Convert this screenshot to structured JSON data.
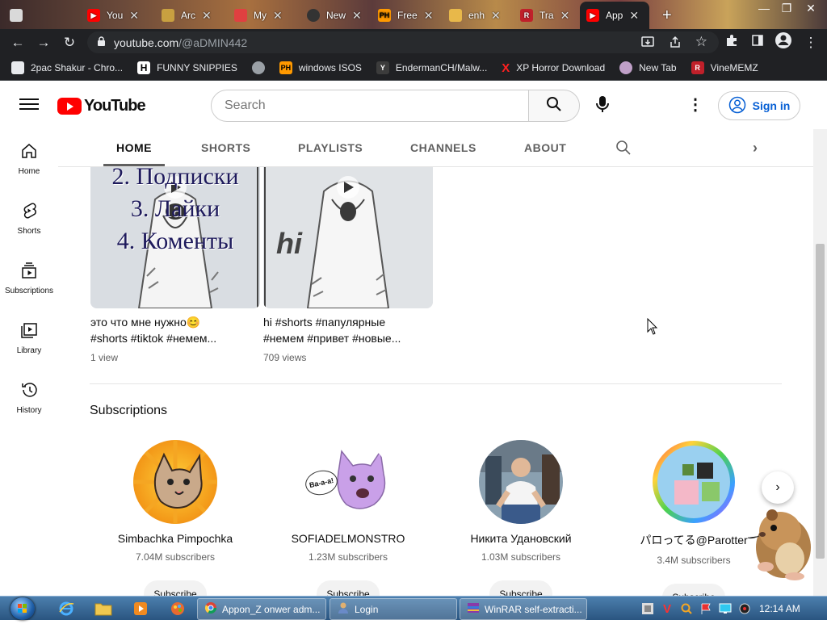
{
  "browser": {
    "tabs": [
      {
        "title": "",
        "favicon": "roblox-icon",
        "color": "#d9d9d9"
      },
      {
        "title": "You",
        "favicon": "youtube-icon",
        "color": "#ff0000"
      },
      {
        "title": "Arc",
        "favicon": "archive-icon",
        "color": "#c8a040"
      },
      {
        "title": "My",
        "favicon": "photo-icon",
        "color": "#e04040"
      },
      {
        "title": "New",
        "favicon": "github-icon",
        "color": "#333333"
      },
      {
        "title": "Free",
        "favicon": "ph-icon",
        "color": "#ff9900"
      },
      {
        "title": "enh",
        "favicon": "folder-icon",
        "color": "#e8b84a"
      },
      {
        "title": "Tra",
        "favicon": "roblox-icon",
        "color": "#c0202a"
      },
      {
        "title": "App",
        "favicon": "youtube-icon",
        "color": "#ff0000",
        "active": true
      }
    ],
    "new_tab_glyph": "+",
    "window_controls": {
      "minimize": "—",
      "restore": "❐",
      "close": "✕"
    },
    "address": {
      "host": "youtube.com",
      "path": "/@aDMIN442"
    },
    "bookmarks": [
      {
        "label": "2pac Shakur - Chro...",
        "icon": "chrome-app-icon"
      },
      {
        "label": "FUNNY SNIPPIES",
        "icon": "h-icon"
      },
      {
        "label": "",
        "icon": "globe-icon"
      },
      {
        "label": "windows ISOS",
        "icon": "ph-icon"
      },
      {
        "label": "EndermanCH/Malw...",
        "icon": "ycombinator-icon"
      },
      {
        "label": "XP Horror Download",
        "icon": "x-icon"
      },
      {
        "label": "New Tab",
        "icon": "newtab-icon"
      },
      {
        "label": "VineMEMZ",
        "icon": "roblox-icon"
      }
    ]
  },
  "youtube": {
    "logo_text": "YouTube",
    "search_placeholder": "Search",
    "signin_label": "Sign in",
    "sidebar": [
      {
        "label": "Home",
        "icon": "home-icon"
      },
      {
        "label": "Shorts",
        "icon": "shorts-icon"
      },
      {
        "label": "Subscriptions",
        "icon": "subscriptions-icon"
      },
      {
        "label": "Library",
        "icon": "library-icon"
      },
      {
        "label": "History",
        "icon": "history-icon"
      }
    ],
    "channel_tabs": [
      "HOME",
      "SHORTS",
      "PLAYLISTS",
      "CHANNELS",
      "ABOUT"
    ],
    "videos": [
      {
        "title_line1": "это что мне нужно😊",
        "title_line2": "#shorts #tiktok #немем...",
        "views": "1 view",
        "overlay_lines": [
          "2. Подписки",
          "3. Лайки",
          "4. Коменты"
        ]
      },
      {
        "title_line1": "hi #shorts #папулярные",
        "title_line2": "#немем #привет #новые...",
        "views": "709 views",
        "overlay_lines": [
          "hi"
        ]
      }
    ],
    "subscriptions_heading": "Subscriptions",
    "channels": [
      {
        "name": "Simbachka Pimpochka",
        "subscribers": "7.04M subscribers",
        "button": "Subscribe"
      },
      {
        "name": "SOFIADELMONSTRO",
        "subscribers": "1.23M subscribers",
        "button": "Subscribe",
        "speech": "Ba-a-a!"
      },
      {
        "name": "Никита Удановский",
        "subscribers": "1.03M subscribers",
        "button": "Subscribe"
      },
      {
        "name": "パロってる@Parotter",
        "subscribers": "3.4M subscribers",
        "button": "Subscribe"
      }
    ]
  },
  "taskbar": {
    "tasks": [
      {
        "label": "Appon_Z onwer adm...",
        "icon": "chrome-icon"
      },
      {
        "label": "Login",
        "icon": "user-icon"
      },
      {
        "label": "WinRAR self-extracti...",
        "icon": "winrar-icon"
      }
    ],
    "clock": "12:14 AM"
  }
}
